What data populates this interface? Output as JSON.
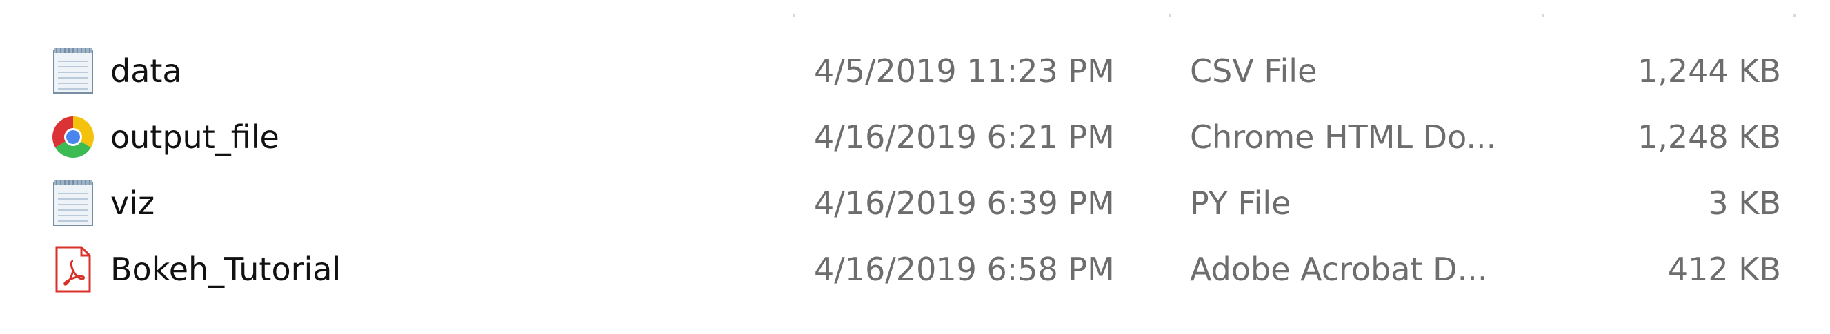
{
  "files": [
    {
      "name": "data",
      "date_modified": "4/5/2019 11:23 PM",
      "type": "CSV File",
      "size": "1,244 KB",
      "icon": "notepad-file-icon"
    },
    {
      "name": "output_file",
      "date_modified": "4/16/2019 6:21 PM",
      "type": "Chrome HTML Do...",
      "size": "1,248 KB",
      "icon": "chrome-icon"
    },
    {
      "name": "viz",
      "date_modified": "4/16/2019 6:39 PM",
      "type": "PY File",
      "size": "3 KB",
      "icon": "notepad-file-icon"
    },
    {
      "name": "Bokeh_Tutorial",
      "date_modified": "4/16/2019 6:58 PM",
      "type": "Adobe Acrobat D...",
      "size": "412 KB",
      "icon": "pdf-file-icon"
    }
  ],
  "colors": {
    "name_text": "#111111",
    "detail_text": "#6d6d6d",
    "pdf_red": "#d9322b",
    "notepad_blue": "#7ea6cf"
  }
}
